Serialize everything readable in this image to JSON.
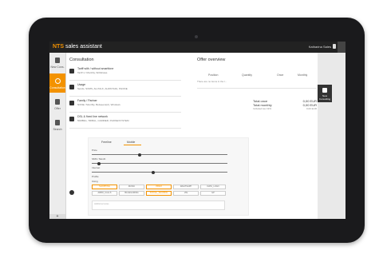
{
  "app": {
    "brand_accent": "NTS",
    "brand_rest": " sales assistant",
    "user_name": "Katharina Sales"
  },
  "sidebar": {
    "items": [
      {
        "label": "New Cons.",
        "icon": "tablet-icon"
      },
      {
        "label": "Consultation",
        "icon": "bulb-icon"
      },
      {
        "label": "Offer",
        "icon": "monitor-icon"
      },
      {
        "label": "Search",
        "icon": "search-icon"
      }
    ],
    "add_label": "+"
  },
  "consultation": {
    "title": "Consultation",
    "rows": [
      {
        "title": "Tariff with / without smartfone",
        "subtitle": "Tariff 1 / Monthly, Withdraws"
      },
      {
        "title": "Usage",
        "subtitle": "Sends, SOMS, ALLTALK, ALWAYS4G, PHONE"
      },
      {
        "title": "Family / Partner",
        "subtitle": "NONE / Monthly, Betweens(2), Windows"
      },
      {
        "title": "DSL & fixed line network",
        "subtitle": "50MBit/s, TRIBAL, CARRIER, PHONE/SYSTEM"
      }
    ]
  },
  "offer": {
    "title": "Offer overview",
    "columns": [
      "Position",
      "Quantity",
      "Once",
      "Monthly"
    ],
    "empty_row": "There are no items in the l...",
    "totals": [
      {
        "label": "Total once",
        "value": "0,00 EUR"
      },
      {
        "label": "Total monthly",
        "value": "0,00 EUR"
      },
      {
        "label": "Included tax 19%",
        "value": "0,00 EUR"
      }
    ]
  },
  "config": {
    "tabs": [
      "Freeline",
      "Mobile"
    ],
    "sliders": [
      {
        "label": "Price",
        "level": 0.35
      },
      {
        "label": "SMS / Month",
        "level": 0.05
      },
      {
        "label": "Internet",
        "level": 0.45
      },
      {
        "label": "Profile",
        "level": 0.0
      }
    ],
    "options_label": "Using",
    "chips": [
      {
        "label": "SHOPPING",
        "on": true
      },
      {
        "label": "MUSIC",
        "on": false
      },
      {
        "label": "VIDEO",
        "on": true
      },
      {
        "label": "WHATSAPP",
        "on": false
      },
      {
        "label": "DATA_LOAN",
        "on": false
      },
      {
        "label": "ARBO_CALLS",
        "on": false
      },
      {
        "label": "BLUEGAMING",
        "on": false
      },
      {
        "label": "SOCIAL_SHARING",
        "on": true
      },
      {
        "label": "LTE",
        "on": false
      },
      {
        "label": "GP",
        "on": false
      }
    ],
    "notes_placeholder": "Additional notes"
  },
  "right_panel": {
    "new_consult": "New Consulting"
  }
}
